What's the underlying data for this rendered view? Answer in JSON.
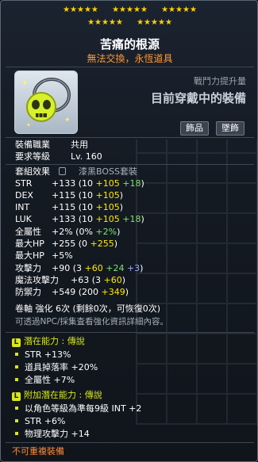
{
  "stars": {
    "row1_groups": 3,
    "row2_groups": 2,
    "per_group": 5,
    "color": "#ffd000"
  },
  "item": {
    "name": "苦痛的根源",
    "subtitle": "無法交換，永恆道具",
    "power_label": "戰鬥力提升量",
    "equip_status": "目前穿戴中的裝備",
    "tags": [
      "飾品",
      "墜飾"
    ]
  },
  "requirements": {
    "job_label": "裝備職業",
    "job_value": "共用",
    "level_label": "要求等級",
    "level_value": "Lv. 160"
  },
  "set": {
    "label": "套組效果",
    "value": "漆黑BOSS套裝"
  },
  "stats": [
    {
      "label": "STR",
      "base": "+133",
      "open": "(10",
      "star": "+105",
      "flame": "+18",
      "close": ")"
    },
    {
      "label": "DEX",
      "base": "+115",
      "open": "(10",
      "star": "+105",
      "flame": "",
      "close": ")"
    },
    {
      "label": "INT",
      "base": "+115",
      "open": "(10",
      "star": "+105",
      "flame": "",
      "close": ")"
    },
    {
      "label": "LUK",
      "base": "+133",
      "open": "(10",
      "star": "+105",
      "flame": "+18",
      "close": ")"
    },
    {
      "label": "全屬性",
      "base": "+2%",
      "open": "(0%",
      "star": "",
      "flame": "+2%",
      "close": ")"
    },
    {
      "label": "最大HP",
      "base": "+255",
      "open": "(0",
      "star": "+255",
      "flame": "",
      "close": ")"
    },
    {
      "label": "最大HP",
      "base": "+5%",
      "open": "",
      "star": "",
      "flame": "",
      "close": ""
    },
    {
      "label": "攻擊力",
      "base": "+90",
      "open": "(3",
      "star": "+60",
      "flame": "+24",
      "extra": "+3",
      "close": ")"
    },
    {
      "label": "魔法攻擊力",
      "base": "+63",
      "open": "(3",
      "star": "+60",
      "flame": "",
      "close": ")"
    },
    {
      "label": "防禦力",
      "base": "+549",
      "open": "(200",
      "star": "+349",
      "flame": "",
      "close": ")"
    }
  ],
  "scroll": {
    "line": "卷軸 強化 6次 (剩餘0次，可恢復0次)",
    "hint": "可透過NPC/採集査看強化資訊詳細內容。"
  },
  "potential": {
    "badge": "L",
    "header": "潛在能力 : 傳說",
    "lines": [
      "STR +13%",
      "道具掉落率 +20%",
      "全屬性 +7%"
    ]
  },
  "additional": {
    "badge": "L",
    "header": "附加潛在能力 : 傳說",
    "lines": [
      "以角色等級為準每9級 INT +2",
      "STR +6%",
      "物理攻擊力 +14"
    ]
  },
  "footer": "不可重複裝備"
}
